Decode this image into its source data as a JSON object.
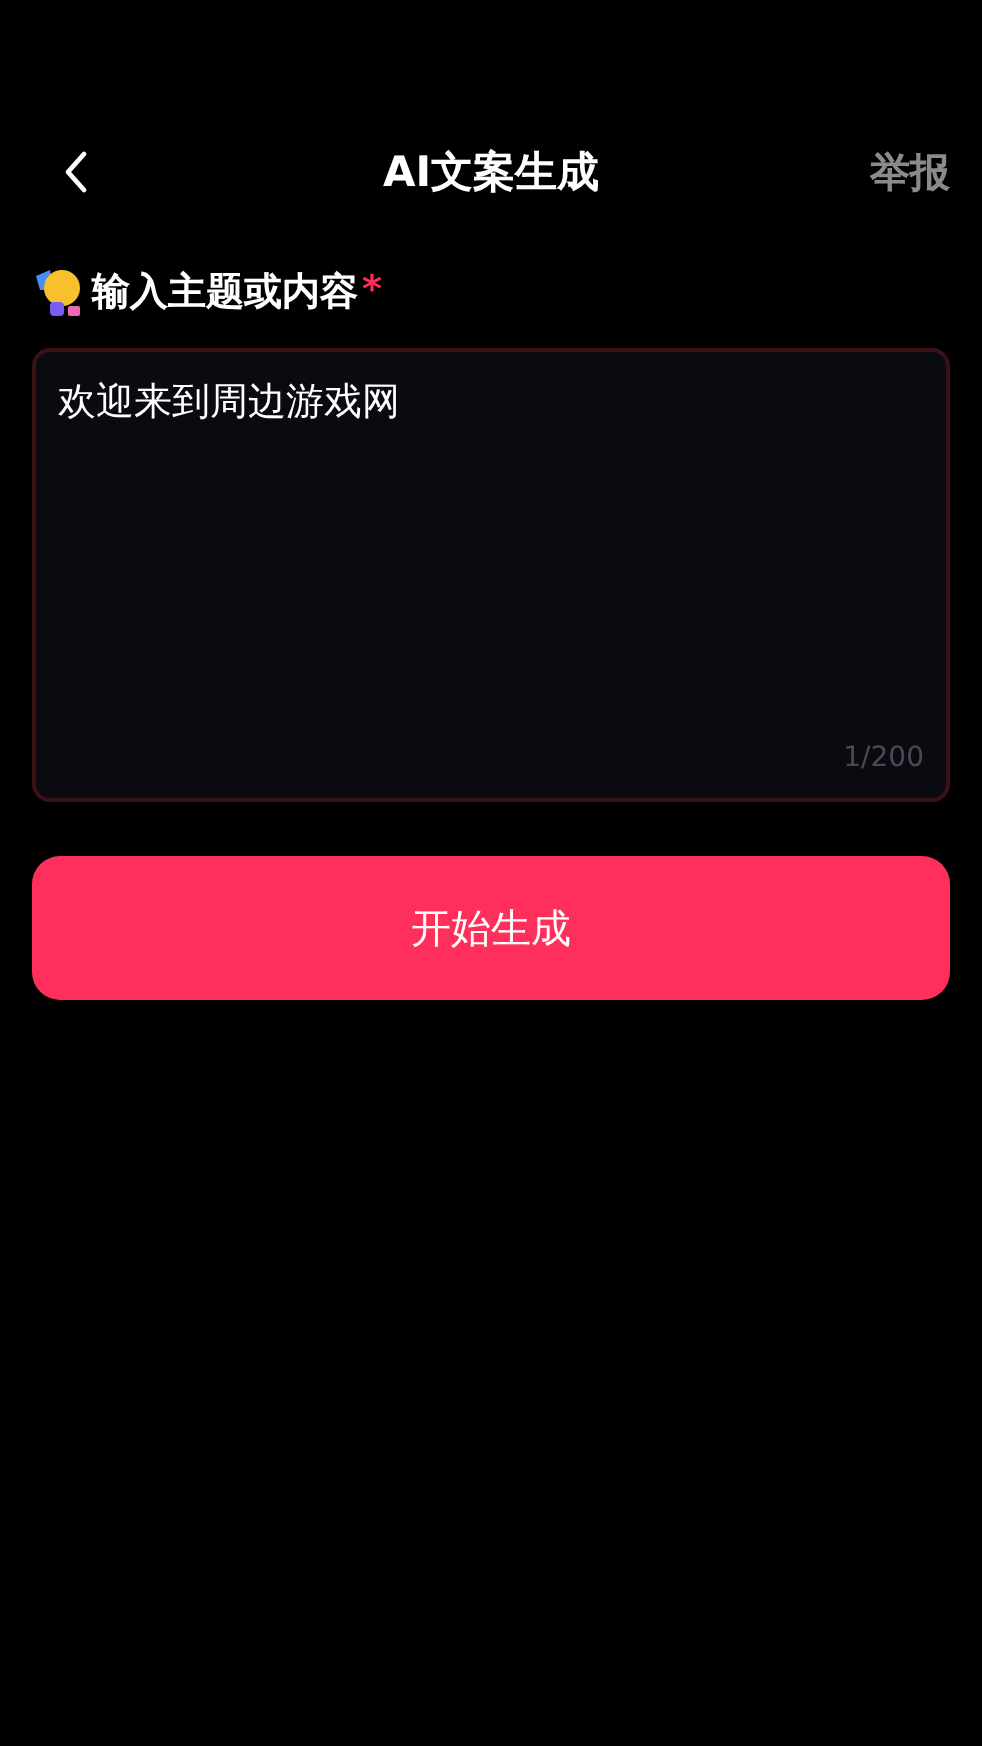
{
  "header": {
    "title": "AI文案生成",
    "report": "举报"
  },
  "prompt": {
    "label": "输入主题或内容",
    "required_mark": "*",
    "value": "欢迎来到周边游戏网",
    "counter": "1/200"
  },
  "generate_button": "开始生成"
}
